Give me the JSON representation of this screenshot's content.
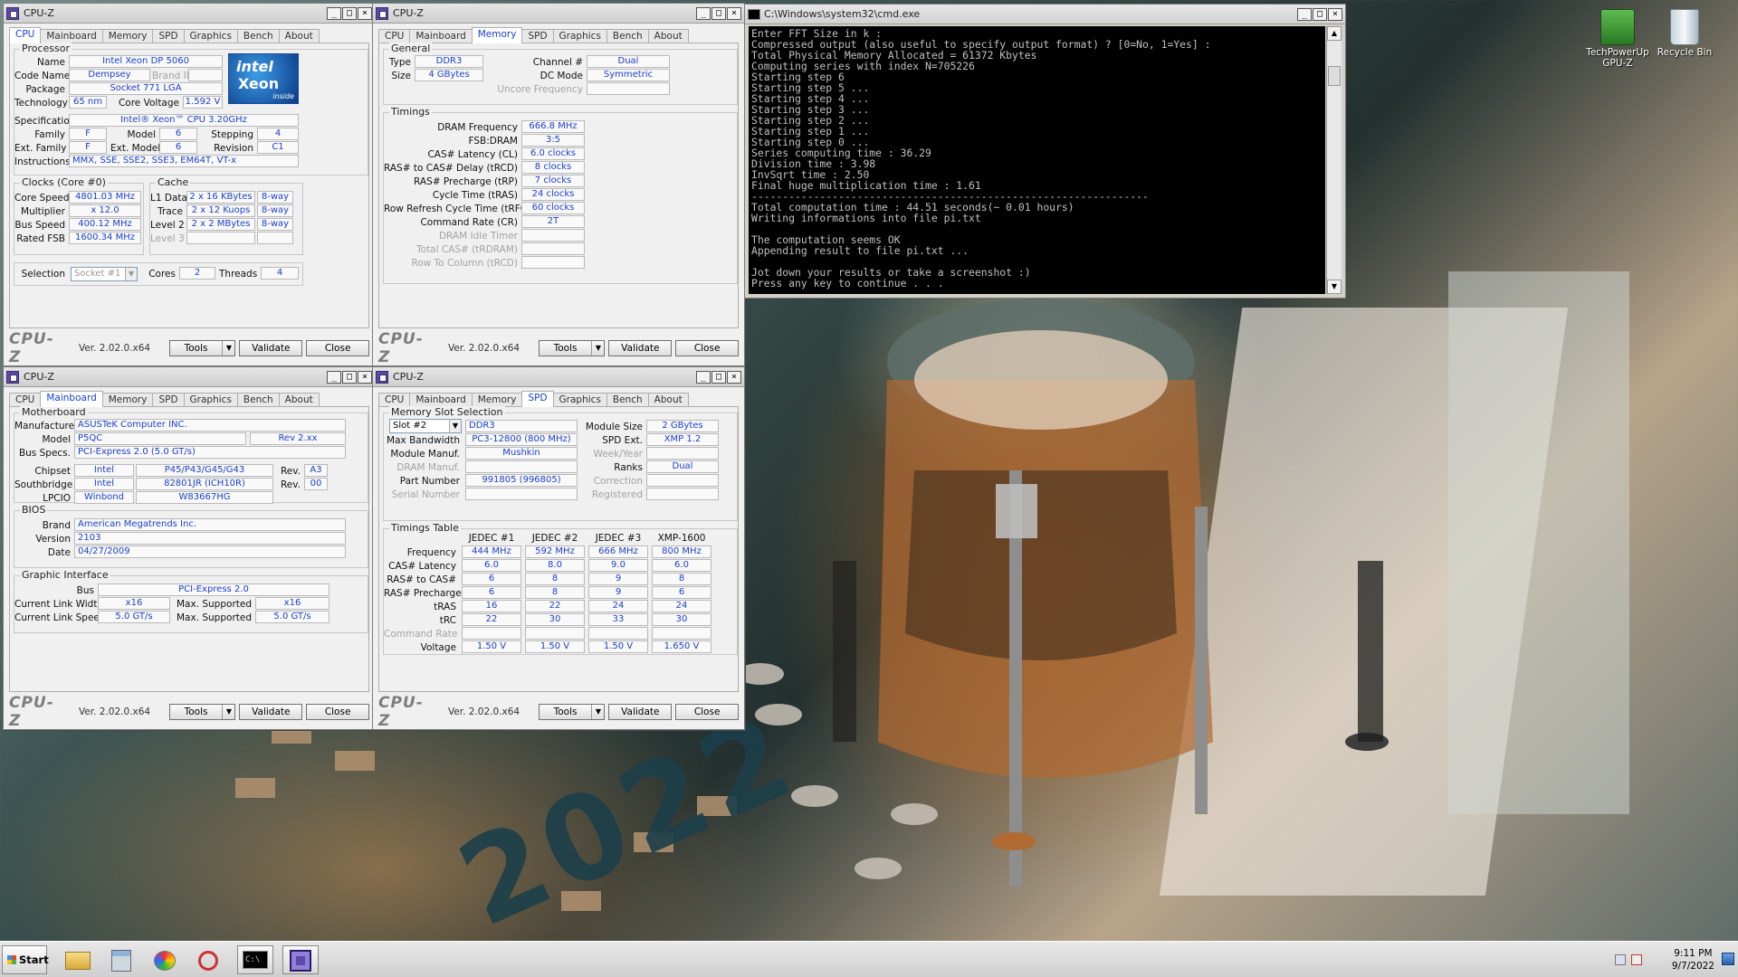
{
  "desktop": {
    "art_text": "2022",
    "icons": [
      {
        "label": "TechPowerUp GPU-Z"
      },
      {
        "label": "Recycle Bin"
      }
    ]
  },
  "cpuz_common": {
    "brand": "CPU-Z",
    "version": "Ver. 2.02.0.x64",
    "tools": "Tools",
    "validate": "Validate",
    "close": "Close",
    "title": "CPU-Z",
    "tabs": [
      "CPU",
      "Mainboard",
      "Memory",
      "SPD",
      "Graphics",
      "Bench",
      "About"
    ],
    "win_min": "_",
    "win_max": "□",
    "win_close": "×"
  },
  "cpu_tab": {
    "processor": {
      "group": "Processor",
      "name_l": "Name",
      "name": "Intel Xeon DP 5060",
      "codename_l": "Code Name",
      "codename": "Dempsey",
      "brandid_l": "Brand ID",
      "package_l": "Package",
      "package": "Socket 771 LGA",
      "tech_l": "Technology",
      "tech": "65 nm",
      "cvolt_l": "Core Voltage",
      "cvolt": "1.592 V",
      "spec_l": "Specification",
      "spec": "Intel® Xeon™ CPU 3.20GHz",
      "family_l": "Family",
      "family": "F",
      "model_l": "Model",
      "model": "6",
      "stepping_l": "Stepping",
      "stepping": "4",
      "extfam_l": "Ext. Family",
      "extfam": "F",
      "extmodel_l": "Ext. Model",
      "extmodel": "6",
      "revision_l": "Revision",
      "revision": "C1",
      "instr_l": "Instructions",
      "instr": "MMX, SSE, SSE2, SSE3, EM64T, VT-x",
      "logo_brand": "intel",
      "logo_name": "Xeon",
      "logo_inside": "inside"
    },
    "clocks": {
      "group": "Clocks (Core #0)",
      "speed_l": "Core Speed",
      "speed": "4801.03 MHz",
      "mult_l": "Multiplier",
      "mult": "x 12.0",
      "bus_l": "Bus Speed",
      "bus": "400.12 MHz",
      "fsb_l": "Rated FSB",
      "fsb": "1600.34 MHz"
    },
    "cache": {
      "group": "Cache",
      "l1_l": "L1 Data",
      "l1": "2 x 16 KBytes",
      "l1w": "8-way",
      "trace_l": "Trace",
      "trace": "2 x 12 Kuops",
      "tracew": "8-way",
      "l2_l": "Level 2",
      "l2": "2 x 2 MBytes",
      "l2w": "8-way",
      "l3_l": "Level 3"
    },
    "sel_l": "Selection",
    "sel": "Socket #1",
    "cores_l": "Cores",
    "cores": "2",
    "threads_l": "Threads",
    "threads": "4"
  },
  "memory_tab": {
    "general": {
      "group": "General",
      "type_l": "Type",
      "type": "DDR3",
      "size_l": "Size",
      "size": "4 GBytes",
      "chan_l": "Channel #",
      "chan": "Dual",
      "dc_l": "DC Mode",
      "dc": "Symmetric",
      "unc_l": "Uncore Frequency"
    },
    "timings": {
      "group": "Timings",
      "rows": [
        {
          "l": "DRAM Frequency",
          "v": "666.8 MHz"
        },
        {
          "l": "FSB:DRAM",
          "v": "3:5"
        },
        {
          "l": "CAS# Latency (CL)",
          "v": "6.0 clocks"
        },
        {
          "l": "RAS# to CAS# Delay (tRCD)",
          "v": "8 clocks"
        },
        {
          "l": "RAS# Precharge (tRP)",
          "v": "7 clocks"
        },
        {
          "l": "Cycle Time (tRAS)",
          "v": "24 clocks"
        },
        {
          "l": "Row Refresh Cycle Time (tRFC)",
          "v": "60 clocks"
        },
        {
          "l": "Command Rate (CR)",
          "v": "2T"
        },
        {
          "l": "DRAM Idle Timer",
          "v": ""
        },
        {
          "l": "Total CAS# (tRDRAM)",
          "v": ""
        },
        {
          "l": "Row To Column (tRCD)",
          "v": ""
        }
      ]
    }
  },
  "mainboard_tab": {
    "mb": {
      "group": "Motherboard",
      "manuf_l": "Manufacturer",
      "manuf": "ASUSTeK Computer INC.",
      "model_l": "Model",
      "model": "P5QC",
      "rev": "Rev 2.xx",
      "bus_l": "Bus Specs.",
      "bus": "PCI-Express 2.0 (5.0 GT/s)",
      "chipset_l": "Chipset",
      "chipset_v": "Intel",
      "chipset": "P45/P43/G45/G43",
      "chip_rev_l": "Rev.",
      "chip_rev": "A3",
      "sb_l": "Southbridge",
      "sb_v": "Intel",
      "sb": "82801JR (ICH10R)",
      "sb_rev_l": "Rev.",
      "sb_rev": "00",
      "lpcio_l": "LPCIO",
      "lpcio_v": "Winbond",
      "lpcio": "W83667HG"
    },
    "bios": {
      "group": "BIOS",
      "brand_l": "Brand",
      "brand": "American Megatrends Inc.",
      "ver_l": "Version",
      "ver": "2103",
      "date_l": "Date",
      "date": "04/27/2009"
    },
    "gi": {
      "group": "Graphic Interface",
      "bus_l": "Bus",
      "bus": "PCI-Express 2.0",
      "lw_l": "Current Link Width",
      "lw": "x16",
      "mlw_l": "Max. Supported",
      "mlw": "x16",
      "ls_l": "Current Link Speed",
      "ls": "5.0 GT/s",
      "mls_l": "Max. Supported",
      "mls": "5.0 GT/s"
    }
  },
  "spd_tab": {
    "slot": {
      "group": "Memory Slot Selection",
      "slot": "Slot #2",
      "type": "DDR3",
      "msize_l": "Module Size",
      "msize": "2 GBytes",
      "bw_l": "Max Bandwidth",
      "bw": "PC3-12800 (800 MHz)",
      "ext_l": "SPD Ext.",
      "ext": "XMP 1.2",
      "manuf_l": "Module Manuf.",
      "manuf": "Mushkin",
      "wy_l": "Week/Year",
      "dram_l": "DRAM Manuf.",
      "ranks_l": "Ranks",
      "ranks": "Dual",
      "pn_l": "Part Number",
      "pn": "991805 (996805)",
      "corr_l": "Correction",
      "sn_l": "Serial Number",
      "reg_l": "Registered"
    },
    "tt": {
      "group": "Timings Table",
      "cols": [
        "JEDEC #1",
        "JEDEC #2",
        "JEDEC #3",
        "XMP-1600"
      ],
      "rows": [
        {
          "l": "Frequency",
          "v": [
            "444 MHz",
            "592 MHz",
            "666 MHz",
            "800 MHz"
          ]
        },
        {
          "l": "CAS# Latency",
          "v": [
            "6.0",
            "8.0",
            "9.0",
            "6.0"
          ]
        },
        {
          "l": "RAS# to CAS#",
          "v": [
            "6",
            "8",
            "9",
            "8"
          ]
        },
        {
          "l": "RAS# Precharge",
          "v": [
            "6",
            "8",
            "9",
            "6"
          ]
        },
        {
          "l": "tRAS",
          "v": [
            "16",
            "22",
            "24",
            "24"
          ]
        },
        {
          "l": "tRC",
          "v": [
            "22",
            "30",
            "33",
            "30"
          ]
        },
        {
          "l": "Command Rate",
          "v": [
            "",
            "",
            "",
            ""
          ]
        },
        {
          "l": "Voltage",
          "v": [
            "1.50 V",
            "1.50 V",
            "1.50 V",
            "1.650 V"
          ]
        }
      ]
    }
  },
  "cmd": {
    "title": "C:\\Windows\\system32\\cmd.exe",
    "lines": [
      "Enter FFT Size in k :",
      "Compressed output (also useful to specify output format) ? [0=No, 1=Yes] :",
      "Total Physical Memory Allocated = 61372 Kbytes",
      "Computing series with index N=705226",
      "Starting step 6",
      "Starting step 5 ...",
      "Starting step 4 ...",
      "Starting step 3 ...",
      "Starting step 2 ...",
      "Starting step 1 ...",
      "Starting step 0 ...",
      "Series computing time : 36.29",
      "Division time : 3.98",
      "InvSqrt time : 2.50",
      "Final huge multiplication time : 1.61",
      "----------------------------------------------------------------",
      "Total computation time : 44.51 seconds(~ 0.01 hours)",
      "Writing informations into file pi.txt",
      "",
      "The computation seems OK",
      "Appending result to file pi.txt ...",
      "",
      "Jot down your results or take a screenshot :)",
      "Press any key to continue . . ."
    ]
  },
  "taskbar": {
    "start": "Start",
    "time": "9:11 PM",
    "date": "9/7/2022",
    "icons": [
      "explorer-icon",
      "calculator-icon",
      "paint-icon",
      "snipping-icon",
      "cmd-icon",
      "cpuz-icon"
    ]
  }
}
